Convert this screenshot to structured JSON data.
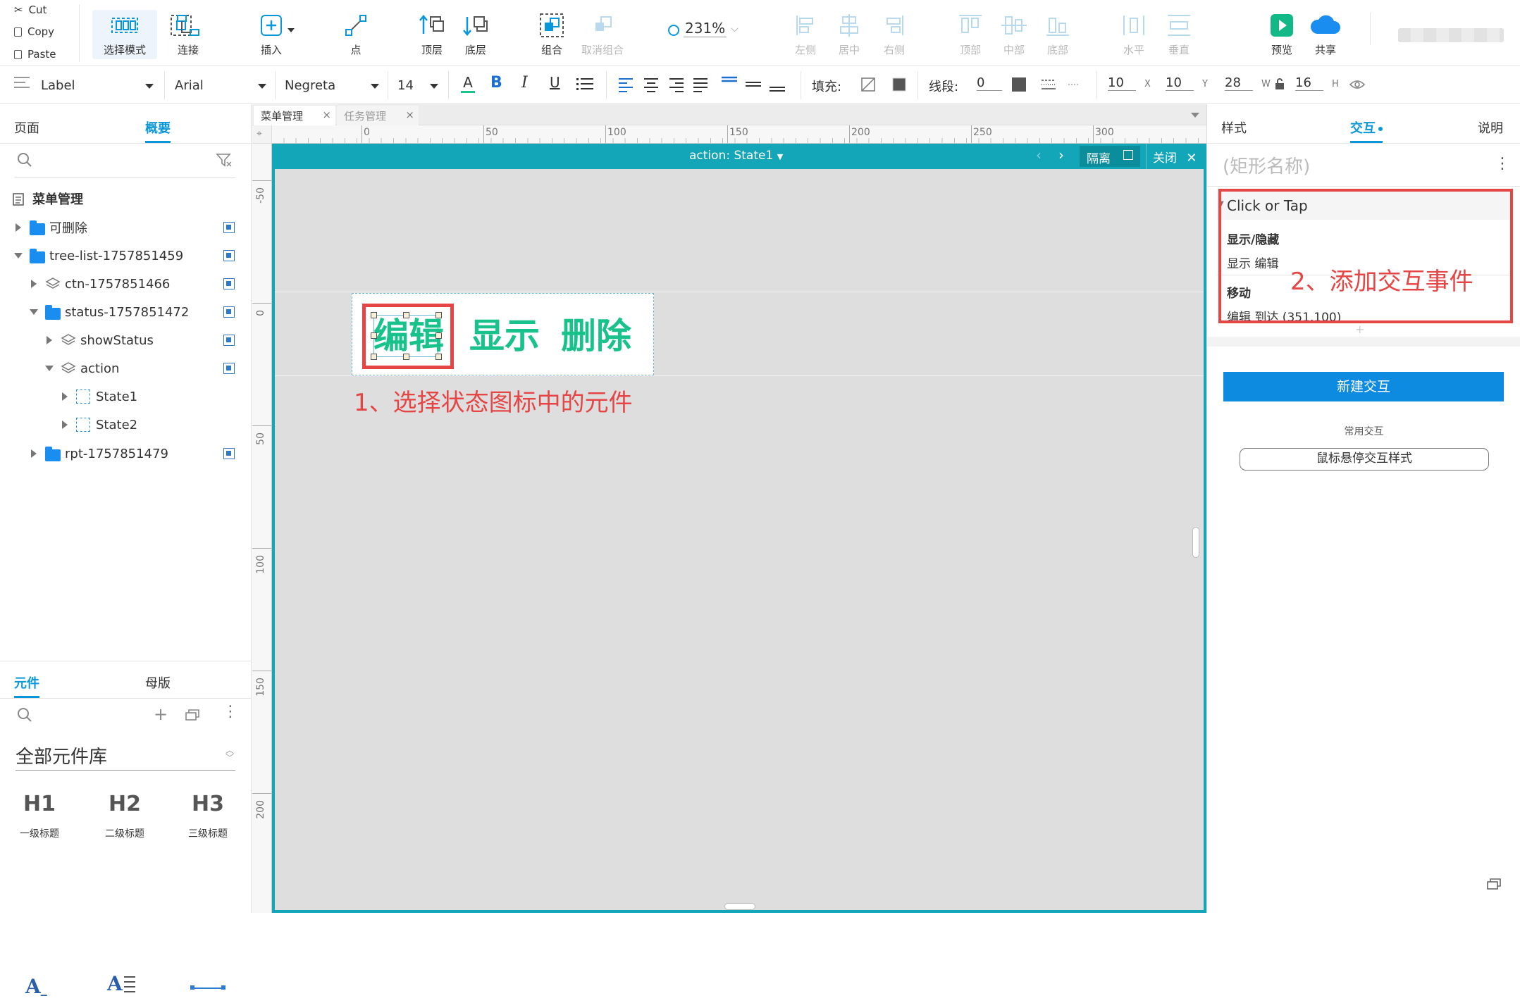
{
  "clipboard": {
    "cut": "Cut",
    "copy": "Copy",
    "paste": "Paste"
  },
  "toolbar": {
    "select_mode": "选择模式",
    "connect": "连接",
    "insert": "插入",
    "point": "点",
    "top_layer": "顶层",
    "bottom_layer": "底层",
    "group": "组合",
    "ungroup": "取消组合",
    "zoom": "231%",
    "align_left": "左侧",
    "align_center": "居中",
    "align_right": "右侧",
    "align_top": "顶部",
    "align_middle": "中部",
    "align_bottom": "底部",
    "distribute_h": "水平",
    "distribute_v": "垂直",
    "preview": "预览",
    "share": "共享"
  },
  "format": {
    "style": "Label",
    "font": "Arial",
    "weight": "Negreta",
    "size": "14",
    "fill_label": "填充:",
    "line_label": "线段:",
    "line_value": "0",
    "x": "10",
    "x_label": "X",
    "y": "10",
    "y_label": "Y",
    "w": "28",
    "w_label": "W",
    "h": "16",
    "h_label": "H"
  },
  "left": {
    "tab_pages": "页面",
    "tab_outline": "概要",
    "tree_title": "菜单管理",
    "tree": [
      {
        "label": "可删除"
      },
      {
        "label": "tree-list-1757851459"
      },
      {
        "label": "ctn-1757851466"
      },
      {
        "label": "status-1757851472"
      },
      {
        "label": "showStatus"
      },
      {
        "label": "action"
      },
      {
        "label": "State1"
      },
      {
        "label": "State2"
      },
      {
        "label": "rpt-1757851479"
      }
    ],
    "tab_widgets": "元件",
    "tab_masters": "母版",
    "library": "全部元件库",
    "widgets": [
      {
        "glyph": "H1",
        "label": "一级标题"
      },
      {
        "glyph": "H2",
        "label": "二级标题"
      },
      {
        "glyph": "H3",
        "label": "三级标题"
      }
    ]
  },
  "canvas": {
    "tabs": [
      "菜单管理",
      "任务管理"
    ],
    "ruler_h": [
      "0",
      "50",
      "100",
      "150",
      "200",
      "250",
      "300"
    ],
    "ruler_v": [
      "-50",
      "0",
      "50",
      "100",
      "150",
      "200"
    ],
    "state_title": "action:  State1",
    "isolate": "隔离",
    "close": "关闭",
    "items": [
      "编辑",
      "显示",
      "删除"
    ],
    "annotation1": "1、选择状态图标中的元件"
  },
  "right": {
    "tab_style": "样式",
    "tab_interact": "交互",
    "tab_notes": "说明",
    "name_placeholder": "(矩形名称)",
    "event": "Click or Tap",
    "action1_title": "显示/隐藏",
    "action1_detail": "显示 编辑",
    "action2_title": "移动",
    "action2_detail": "编辑 到达 (351,100)",
    "annotation2": "2、添加交互事件",
    "new_button": "新建交互",
    "common_label": "常用交互",
    "hover_button": "鼠标悬停交互样式"
  },
  "colors": {
    "accent": "#0a97d9",
    "teal": "#12a6b8",
    "green": "#19c28a",
    "red": "#e64545",
    "primary_button": "#0d8be0"
  }
}
